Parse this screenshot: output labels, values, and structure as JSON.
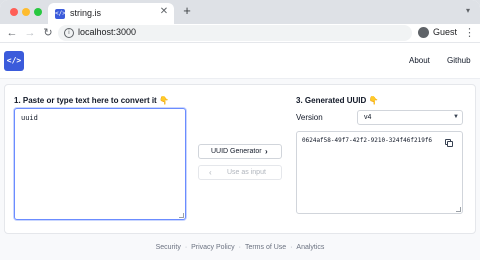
{
  "browser": {
    "tab_title": "string.is",
    "tab_favicon": "</>",
    "close_glyph": "✕",
    "new_tab_glyph": "+",
    "tab_menu_glyph": "▾",
    "url": "localhost:3000",
    "profile_name": "Guest",
    "back_glyph": "←",
    "forward_glyph": "→",
    "reload_glyph": "↻",
    "info_glyph": "i",
    "more_glyph": "⋮"
  },
  "header": {
    "logo_text": "</>",
    "nav_about": "About",
    "nav_github": "Github"
  },
  "converter": {
    "input_title": "1. Paste or type text here to convert it",
    "input_value": "uuid",
    "generator_label": "UUID Generator",
    "generator_icon": "›",
    "use_as_input_label": "Use as input",
    "use_as_input_icon": "‹",
    "output_title": "3. Generated UUID",
    "hand_emoji": "👇",
    "version_label": "Version",
    "version_value": "v4",
    "version_caret": "▼",
    "output_value": "0624af58-49f7-42f2-9210-324f46f219f6"
  },
  "footer": {
    "links": [
      "Security",
      "Privacy Policy",
      "Terms of Use",
      "Analytics"
    ],
    "separator": "·"
  },
  "colors": {
    "accent": "#3b5bdb",
    "focus_border": "#6b8cff"
  }
}
